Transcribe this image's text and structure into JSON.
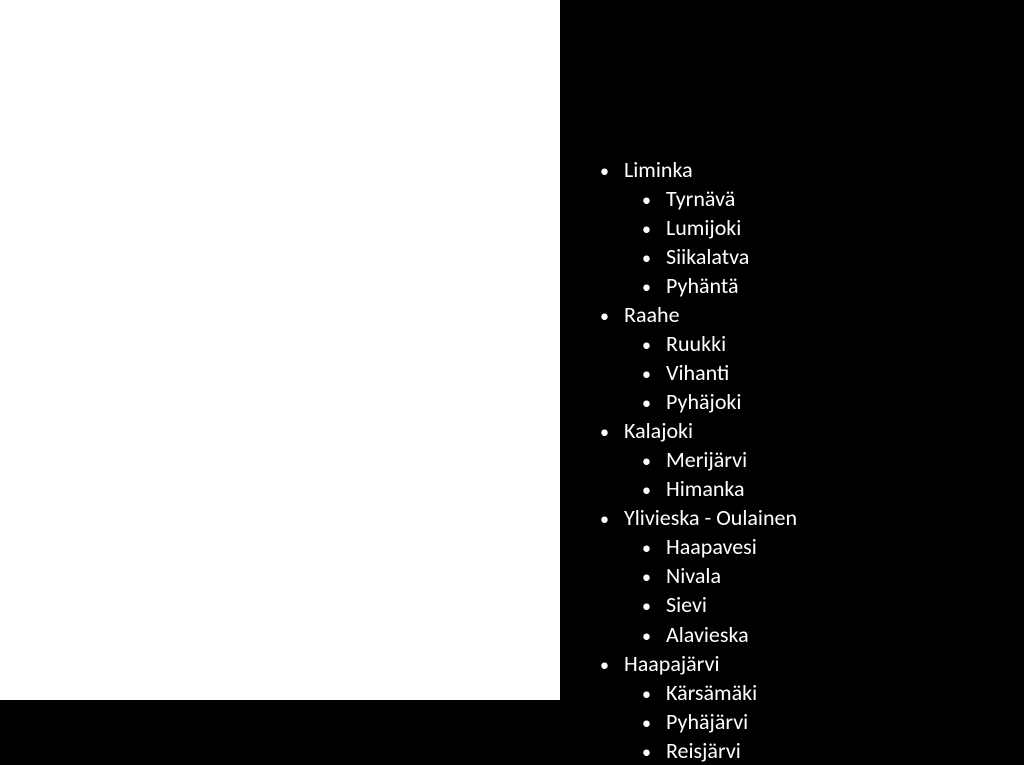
{
  "list": {
    "items": [
      {
        "label": "Liminka",
        "level": 0
      },
      {
        "label": "Tyrnävä",
        "level": 1
      },
      {
        "label": "Lumijoki",
        "level": 1
      },
      {
        "label": "Siikalatva",
        "level": 1
      },
      {
        "label": "Pyhäntä",
        "level": 1
      },
      {
        "label": "Raahe",
        "level": 0
      },
      {
        "label": "Ruukki",
        "level": 1
      },
      {
        "label": "Vihanti",
        "level": 1
      },
      {
        "label": "Pyhäjoki",
        "level": 1
      },
      {
        "label": "Kalajoki",
        "level": 0
      },
      {
        "label": "Merijärvi",
        "level": 1
      },
      {
        "label": "Himanka",
        "level": 1
      },
      {
        "label": "Ylivieska - Oulainen",
        "level": 0
      },
      {
        "label": "Haapavesi",
        "level": 1
      },
      {
        "label": "Nivala",
        "level": 1
      },
      {
        "label": "Sievi",
        "level": 1
      },
      {
        "label": "Alavieska",
        "level": 1
      },
      {
        "label": "Haapajärvi",
        "level": 0
      },
      {
        "label": "Kärsämäki",
        "level": 1
      },
      {
        "label": "Pyhäjärvi",
        "level": 1
      },
      {
        "label": "Reisjärvi",
        "level": 1
      }
    ]
  },
  "colors": {
    "background": "#000000",
    "panel": "#ffffff",
    "text": "#ffffff"
  }
}
